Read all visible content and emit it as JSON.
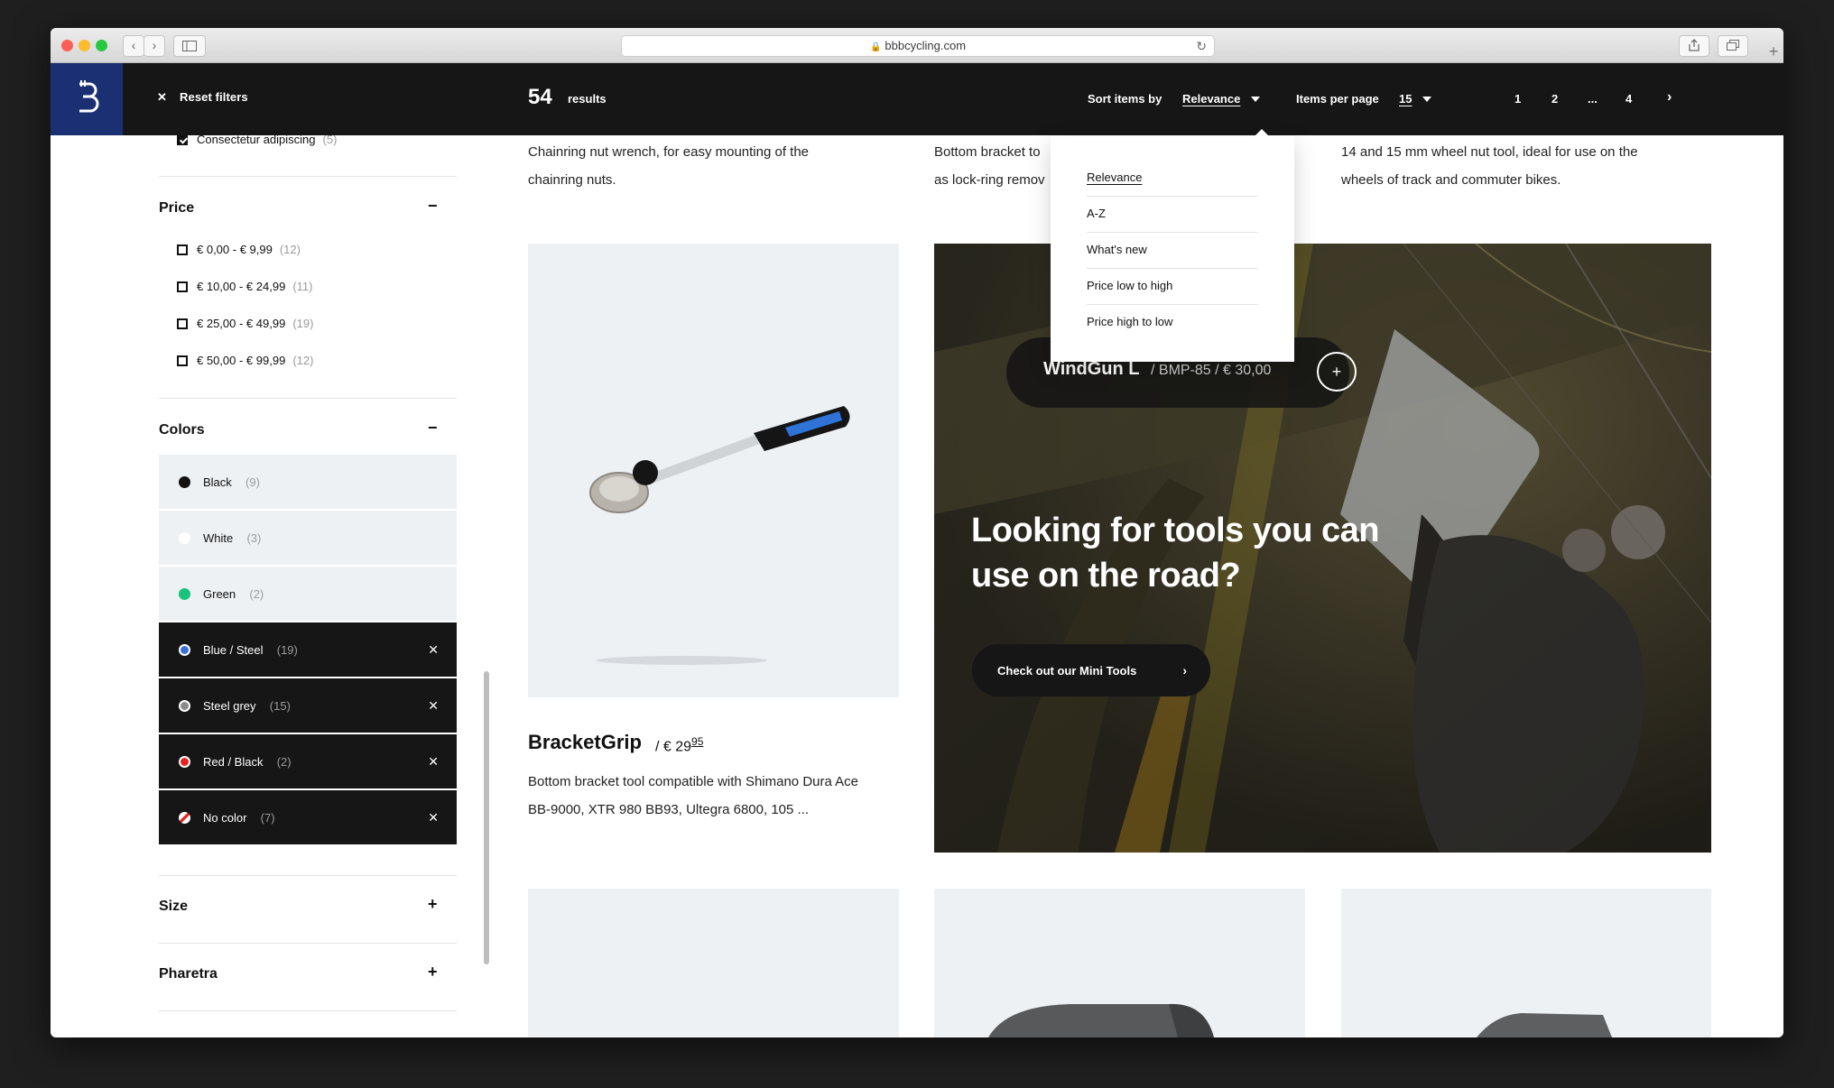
{
  "browser": {
    "url": "bbbcycling.com"
  },
  "header": {
    "reset_label": "Reset filters",
    "results_count": "54",
    "results_label": "results",
    "sort_label": "Sort items by",
    "sort_value": "Relevance",
    "ipp_label": "Items per page",
    "ipp_value": "15",
    "pages": [
      "1",
      "2",
      "...",
      "4"
    ]
  },
  "sidebar": {
    "checked_item": {
      "label": "Consectetur adipiscing",
      "count": "(5)"
    },
    "price": {
      "title": "Price",
      "toggle": "−",
      "items": [
        {
          "label": "€ 0,00 - € 9,99",
          "count": "(12)"
        },
        {
          "label": "€ 10,00 - € 24,99",
          "count": "(11)"
        },
        {
          "label": "€ 25,00 - € 49,99",
          "count": "(19)"
        },
        {
          "label": "€ 50,00 - € 99,99",
          "count": "(12)"
        }
      ]
    },
    "colors": {
      "title": "Colors",
      "toggle": "−",
      "items": [
        {
          "label": "Black",
          "count": "(9)",
          "swatch": "#111111",
          "selected": false
        },
        {
          "label": "White",
          "count": "(3)",
          "swatch": "#ffffff",
          "selected": false
        },
        {
          "label": "Green",
          "count": "(2)",
          "swatch": "#19c37d",
          "selected": false
        },
        {
          "label": "Blue / Steel",
          "count": "(19)",
          "swatch": "#3a6fd8",
          "selected": true
        },
        {
          "label": "Steel grey",
          "count": "(15)",
          "swatch": "#8a8a8a",
          "selected": true
        },
        {
          "label": "Red / Black",
          "count": "(2)",
          "swatch": "#e52323",
          "selected": true
        },
        {
          "label": "No color",
          "count": "(7)",
          "swatch": "none",
          "selected": true
        }
      ]
    },
    "size": {
      "title": "Size",
      "toggle": "+"
    },
    "pharetra": {
      "title": "Pharetra",
      "toggle": "+"
    }
  },
  "products": {
    "top_desc_1": [
      "Chainring nut wrench, for easy mounting of the",
      "chainring nuts."
    ],
    "top_desc_2": [
      "Bottom bracket to",
      "as lock-ring remov"
    ],
    "top_desc_3": [
      "14 and 15 mm wheel nut tool, ideal for use on the",
      "wheels of track and commuter bikes."
    ],
    "bracketgrip": {
      "name": "BracketGrip",
      "price_main": "/ € 29",
      "price_cents": "95",
      "desc": [
        "Bottom bracket tool compatible with Shimano Dura Ace",
        "BB-9000, XTR 980 BB93, Ultegra 6800, 105 ..."
      ]
    }
  },
  "banner": {
    "product_name": "WindGun L",
    "product_meta": "/ BMP-85 / € 30,00",
    "headline": "Looking for tools you can use on the road?",
    "cta": "Check out our Mini Tools"
  },
  "sort_dropdown": {
    "options": [
      "Relevance",
      "A-Z",
      "What's new",
      "Price low to high",
      "Price high to low"
    ]
  },
  "colors": {
    "header_bg": "#161616",
    "logo_bg": "#1b2f73",
    "accent_blue": "#3a6fd8"
  }
}
